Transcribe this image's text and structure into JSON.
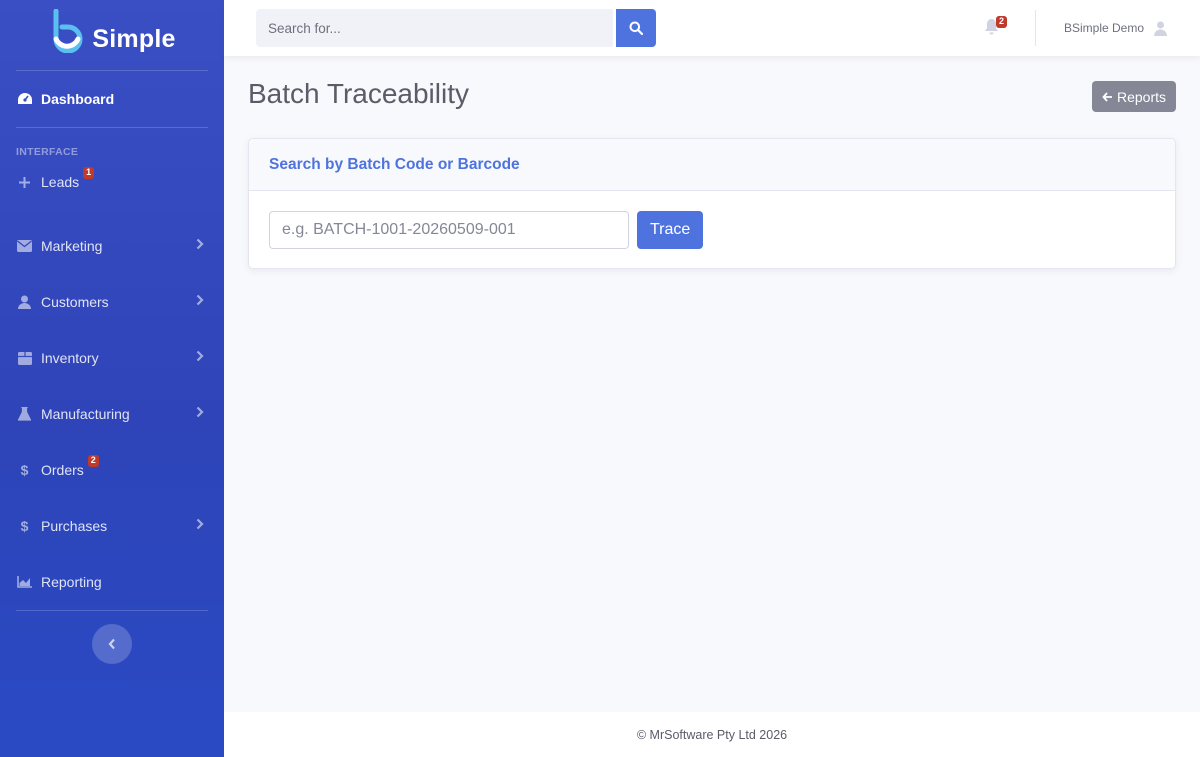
{
  "brand": {
    "name": "Simple"
  },
  "sidebar": {
    "dashboard": {
      "label": "Dashboard",
      "icon": "tachometer-icon"
    },
    "heading": "INTERFACE",
    "items": [
      {
        "label": "Leads",
        "icon": "plus-icon",
        "badge": "1",
        "chevron": false
      },
      {
        "label": "Marketing",
        "icon": "envelope-icon",
        "badge": "",
        "chevron": true
      },
      {
        "label": "Customers",
        "icon": "user-icon",
        "badge": "",
        "chevron": true
      },
      {
        "label": "Inventory",
        "icon": "box-icon",
        "badge": "",
        "chevron": true
      },
      {
        "label": "Manufacturing",
        "icon": "flask-icon",
        "badge": "",
        "chevron": true
      },
      {
        "label": "Orders",
        "icon": "dollar-icon",
        "badge": "2",
        "chevron": false
      },
      {
        "label": "Purchases",
        "icon": "dollar-icon",
        "badge": "",
        "chevron": true
      },
      {
        "label": "Reporting",
        "icon": "chart-area-icon",
        "badge": "",
        "chevron": false
      }
    ]
  },
  "topbar": {
    "search_placeholder": "Search for...",
    "notifications_count": "2",
    "user_name": "BSimple Demo"
  },
  "main": {
    "title": "Batch Traceability",
    "reports_button": "Reports",
    "card_title": "Search by Batch Code or Barcode",
    "input_placeholder": "e.g. BATCH-1001-20260509-001",
    "trace_button": "Trace"
  },
  "footer": {
    "text": "© MrSoftware Pty Ltd 2026"
  },
  "colors": {
    "primary": "#4e73df",
    "sidebar": "#3a4fc4",
    "badge": "#c0392b",
    "secondary_button": "#858796"
  }
}
